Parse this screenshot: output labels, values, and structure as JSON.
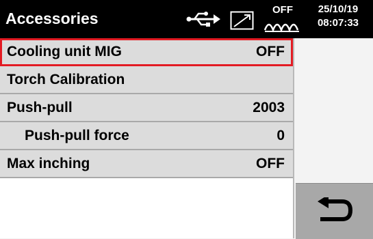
{
  "header": {
    "title": "Accessories",
    "status": "OFF",
    "date": "25/10/19",
    "time": "08:07:33",
    "icons": [
      "usb-icon",
      "calibration-icon",
      "arc-wave-icon"
    ]
  },
  "menu": {
    "items": [
      {
        "label": "Cooling unit MIG",
        "value": "OFF",
        "selected": true
      },
      {
        "label": "Torch Calibration",
        "value": ""
      },
      {
        "label": "Push-pull",
        "value": "2003"
      },
      {
        "label": "Push-pull force",
        "value": "0",
        "indented": true
      },
      {
        "label": "Max inching",
        "value": "OFF"
      }
    ]
  },
  "side": {
    "back_icon": "back-arrow-icon"
  },
  "colors": {
    "header_bg": "#000000",
    "row_bg": "#dcdcdc",
    "selection": "#e31b23",
    "button_bg": "#a8a8a8"
  }
}
